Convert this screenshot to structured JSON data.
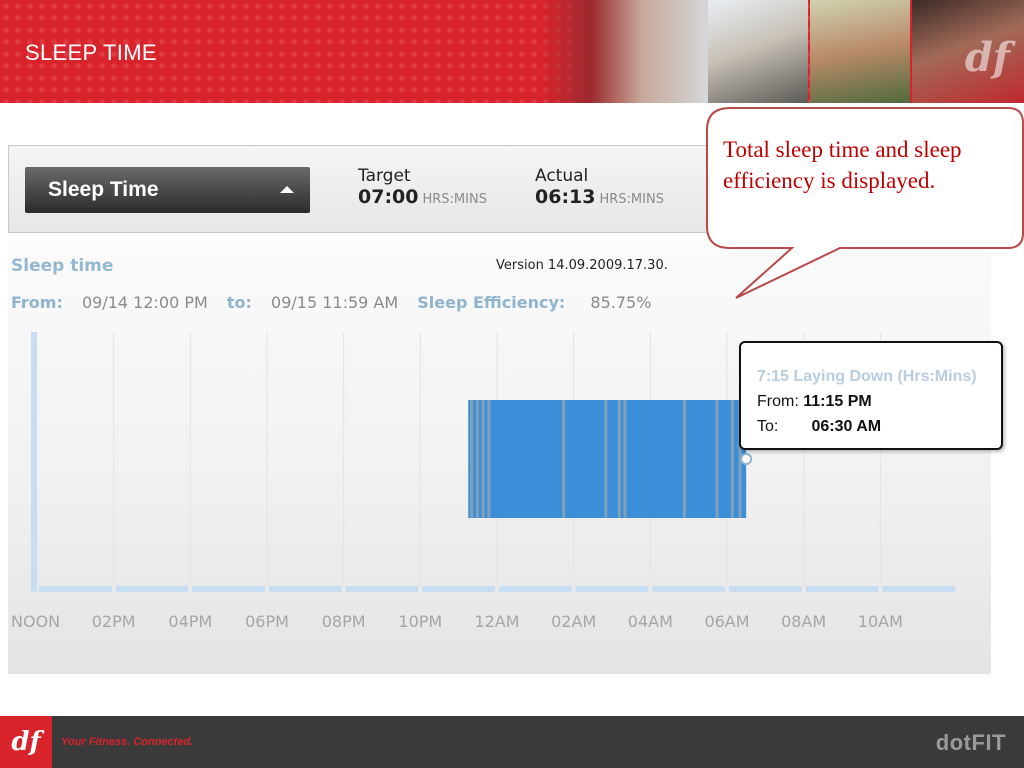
{
  "header": {
    "title": "SLEEP TIME",
    "brand_color": "#d9232b",
    "logo_text": "df"
  },
  "toolbar": {
    "dropdown_label": "Sleep Time",
    "target": {
      "label": "Target",
      "value": "07:00",
      "unit": "HRS:MINS"
    },
    "actual": {
      "label": "Actual",
      "value": "06:13",
      "unit": "HRS:MINS"
    }
  },
  "callout": {
    "text": "Total sleep time and sleep efficiency is displayed.",
    "color": "#c00000"
  },
  "panel": {
    "title": "Sleep time",
    "version": "Version 14.09.2009.17.30.",
    "from_label": "From:",
    "from_value": "09/14 12:00 PM",
    "to_label": "to:",
    "to_value": "09/15 11:59 AM",
    "efficiency_label": "Sleep Efficiency:",
    "efficiency_value": "85.75%"
  },
  "tooltip": {
    "title": "7:15 Laying Down (Hrs:Mins)",
    "from_label": "From:",
    "from_value": "11:15 PM",
    "to_label": "To:",
    "to_value": "06:30 AM"
  },
  "chart_data": {
    "type": "bar",
    "x_ticks": [
      "NOON",
      "02PM",
      "04PM",
      "06PM",
      "08PM",
      "10PM",
      "12AM",
      "02AM",
      "04AM",
      "06AM",
      "08AM",
      "10AM"
    ],
    "x_range_hours_from_noon": [
      0,
      24
    ],
    "sleep_block": {
      "start": "11:15 PM",
      "end": "06:30 AM",
      "start_hours_from_noon": 11.25,
      "end_hours_from_noon": 18.5
    },
    "awake_markers_hours_from_noon": [
      11.3,
      11.45,
      11.6,
      11.75,
      13.7,
      14.8,
      15.15,
      15.3,
      16.85,
      17.7,
      18.1,
      18.3
    ],
    "colors": {
      "sleep": "#3b8fd8",
      "awake": "#8fa3b3",
      "axis": "#c6ddf2",
      "grid": "#e3e3e3"
    },
    "grid": true
  },
  "footer": {
    "tagline": "Your Fitness. Connected.",
    "brand": "dotFIT",
    "logo_text": "df"
  }
}
